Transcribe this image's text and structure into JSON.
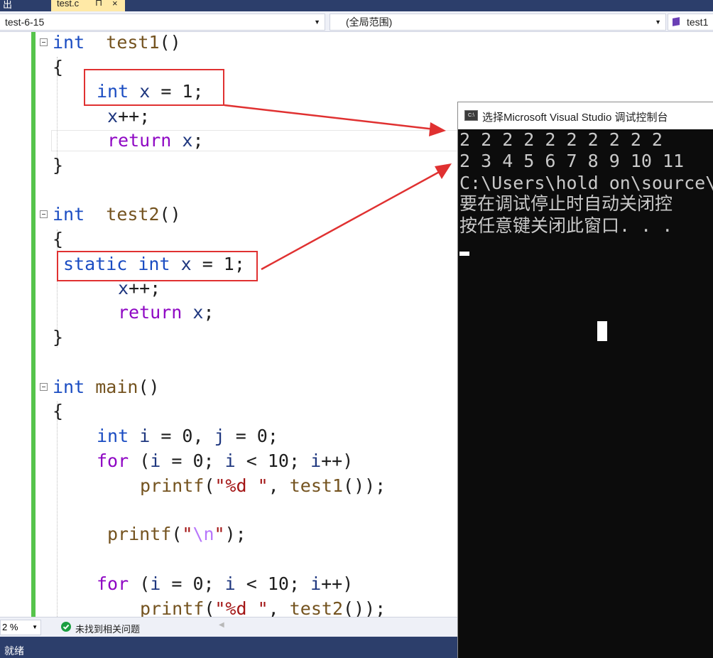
{
  "tabs": {
    "output_label": "出",
    "file_tab": "test.c",
    "pin_glyph": "⊓",
    "close_glyph": "×"
  },
  "nav": {
    "project": "test-6-15",
    "scope": "(全局范围)",
    "member": "test1"
  },
  "code": {
    "t1_type": "int",
    "t1_name": "test1",
    "t1_parens": "()",
    "ob": "{",
    "cb": "}",
    "t1_l1_kw": "int",
    "t1_l1_var": "x",
    "t1_l1_rest": " = 1;",
    "t1_l2_var": "x",
    "t1_l2_rest": "++;",
    "t1_l3_kw": "return",
    "t1_l3_var": "x",
    "t1_l3_rest": ";",
    "t2_type": "int",
    "t2_name": "test2",
    "t2_parens": "()",
    "t2_l1_kw1": "static",
    "t2_l1_kw2": "int",
    "t2_l1_var": "x",
    "t2_l1_rest": " = 1;",
    "t2_l2_var": "x",
    "t2_l2_rest": "++;",
    "t2_l3_kw": "return",
    "t2_l3_var": "x",
    "t2_l3_rest": ";",
    "m_type": "int",
    "m_name": "main",
    "m_parens": "()",
    "m_l1_kw": "int",
    "m_l1_v1": "i",
    "m_l1_mid": " = 0, ",
    "m_l1_v2": "j",
    "m_l1_rest": " = 0;",
    "for_kw": "for",
    "for_open": " (",
    "for_v1": "i",
    "for_mid1": " = 0; ",
    "for_v2": "i",
    "for_mid2": " < 10; ",
    "for_v3": "i",
    "for_end": "++)",
    "printf": "printf",
    "paren_open": "(",
    "fmt_str": "\"%d \"",
    "comma": ", ",
    "call_test1": "test1",
    "call_tail": "());",
    "nl_q1": "\"",
    "nl_esc": "\\n",
    "nl_q2": "\"",
    "nl_tail": ");",
    "call_test2": "test2"
  },
  "console": {
    "title": "选择Microsoft Visual Studio 调试控制台",
    "icon_text": "C:\\",
    "lines": [
      "2 2 2 2 2 2 2 2 2 2",
      "2 3 4 5 6 7 8 9 10 11",
      "C:\\Users\\hold on\\source\\",
      "要在调试停止时自动关闭控",
      "按任意键关闭此窗口. . ."
    ]
  },
  "status": {
    "zoom": "2 %",
    "issues": "未找到相关问题",
    "ready": "就绪"
  },
  "colors": {
    "keyword": "#1a4cc2",
    "function": "#74531f",
    "variable": "#1f377f",
    "control": "#8f08c4",
    "string": "#a31515",
    "annotation": "#e03131",
    "change_bar": "#56c44b",
    "status_bar": "#2c3e6b"
  },
  "icons": [
    "pin-icon",
    "close-icon",
    "class-icon",
    "fold-minus-icon",
    "check-circle-icon",
    "console-app-icon",
    "dropdown-arrow-icon"
  ]
}
